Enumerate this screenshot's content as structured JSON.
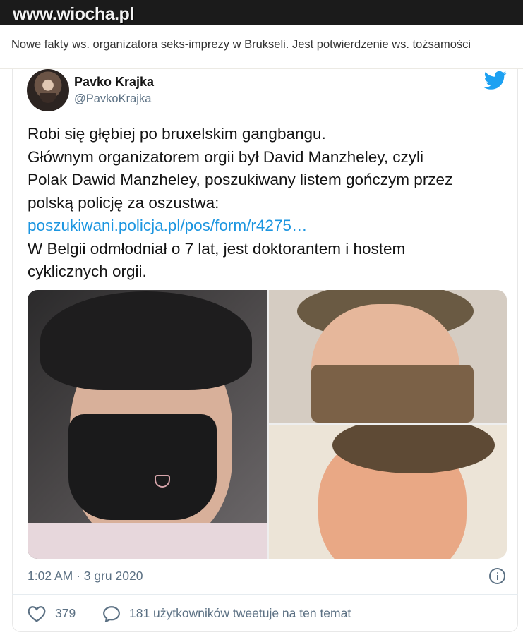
{
  "site": {
    "logo": "www.wiocha.pl"
  },
  "article": {
    "headline": "Nowe fakty ws. organizatora seks-imprezy w Brukseli. Jest potwierdzenie ws. tożsamości"
  },
  "tweet": {
    "author_name": "Pavko Krajka",
    "author_handle": "@PavkoKrajka",
    "lines": [
      "Robi się głębiej po bruxelskim gangbangu.",
      "Głównym organizatorem orgii był David Manzheley, czyli",
      "Polak Dawid Manzheley, poszukiwany listem gończym przez",
      "polską policję za oszustwa:"
    ],
    "link": "poszukiwani.policja.pl/pos/form/r4275…",
    "lines_after": [
      "W Belgii odmłodniał o 7 lat, jest doktorantem i hostem",
      "cyklicznych orgii."
    ],
    "timestamp": "1:02 AM · 3 gru 2020",
    "likes": "379",
    "conversation": "181 użytkowników tweetuje na ten temat"
  },
  "colors": {
    "link": "#1b95e0",
    "twitter_blue": "#1da1f2",
    "muted": "#5b7083",
    "topbar": "#1b1b1b"
  },
  "icons": [
    "twitter-bird-icon",
    "info-icon",
    "heart-icon",
    "comment-bubble-icon"
  ]
}
